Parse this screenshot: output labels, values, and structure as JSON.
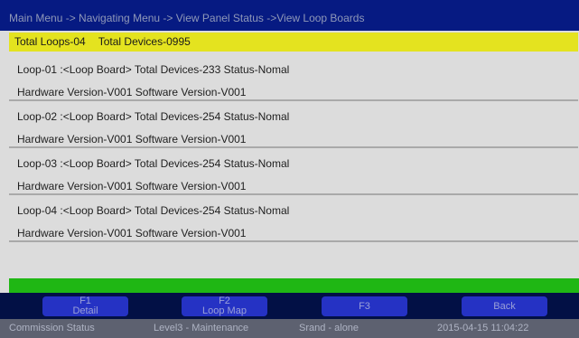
{
  "header": {
    "breadcrumb": "Main Menu -> Navigating Menu -> View Panel  Status ->View Loop Boards"
  },
  "summary": {
    "total_loops": "Total Loops-04",
    "total_devices": "Total Devices-0995"
  },
  "loops": [
    {
      "line1": "Loop-01 :<Loop Board> Total Devices-233 Status-Nomal",
      "line2": "Hardware Version-V001 Software Version-V001"
    },
    {
      "line1": "Loop-02 :<Loop Board> Total Devices-254 Status-Nomal",
      "line2": "Hardware Version-V001 Software Version-V001"
    },
    {
      "line1": "Loop-03 :<Loop Board> Total Devices-254 Status-Nomal",
      "line2": "Hardware Version-V001 Software Version-V001"
    },
    {
      "line1": "Loop-04 :<Loop Board> Total Devices-254 Status-Nomal",
      "line2": "Hardware Version-V001 Software Version-V001"
    }
  ],
  "function_keys": {
    "f1": {
      "num": "F1",
      "label": "Detail"
    },
    "f2": {
      "num": "F2",
      "label": "Loop Map"
    },
    "f3": {
      "label": "F3"
    },
    "back": {
      "label": "Back"
    }
  },
  "footer": {
    "commission": "Commission Status",
    "level": "Level3 - Maintenance",
    "mode": "Srand - alone",
    "datetime": "2015-04-15 11:04:22"
  },
  "colors": {
    "title_bar": "#061a82",
    "summary_highlight": "#e4e31f",
    "status_green": "#1fb714",
    "function_key": "#2532c4",
    "footer": "#5d6170"
  }
}
